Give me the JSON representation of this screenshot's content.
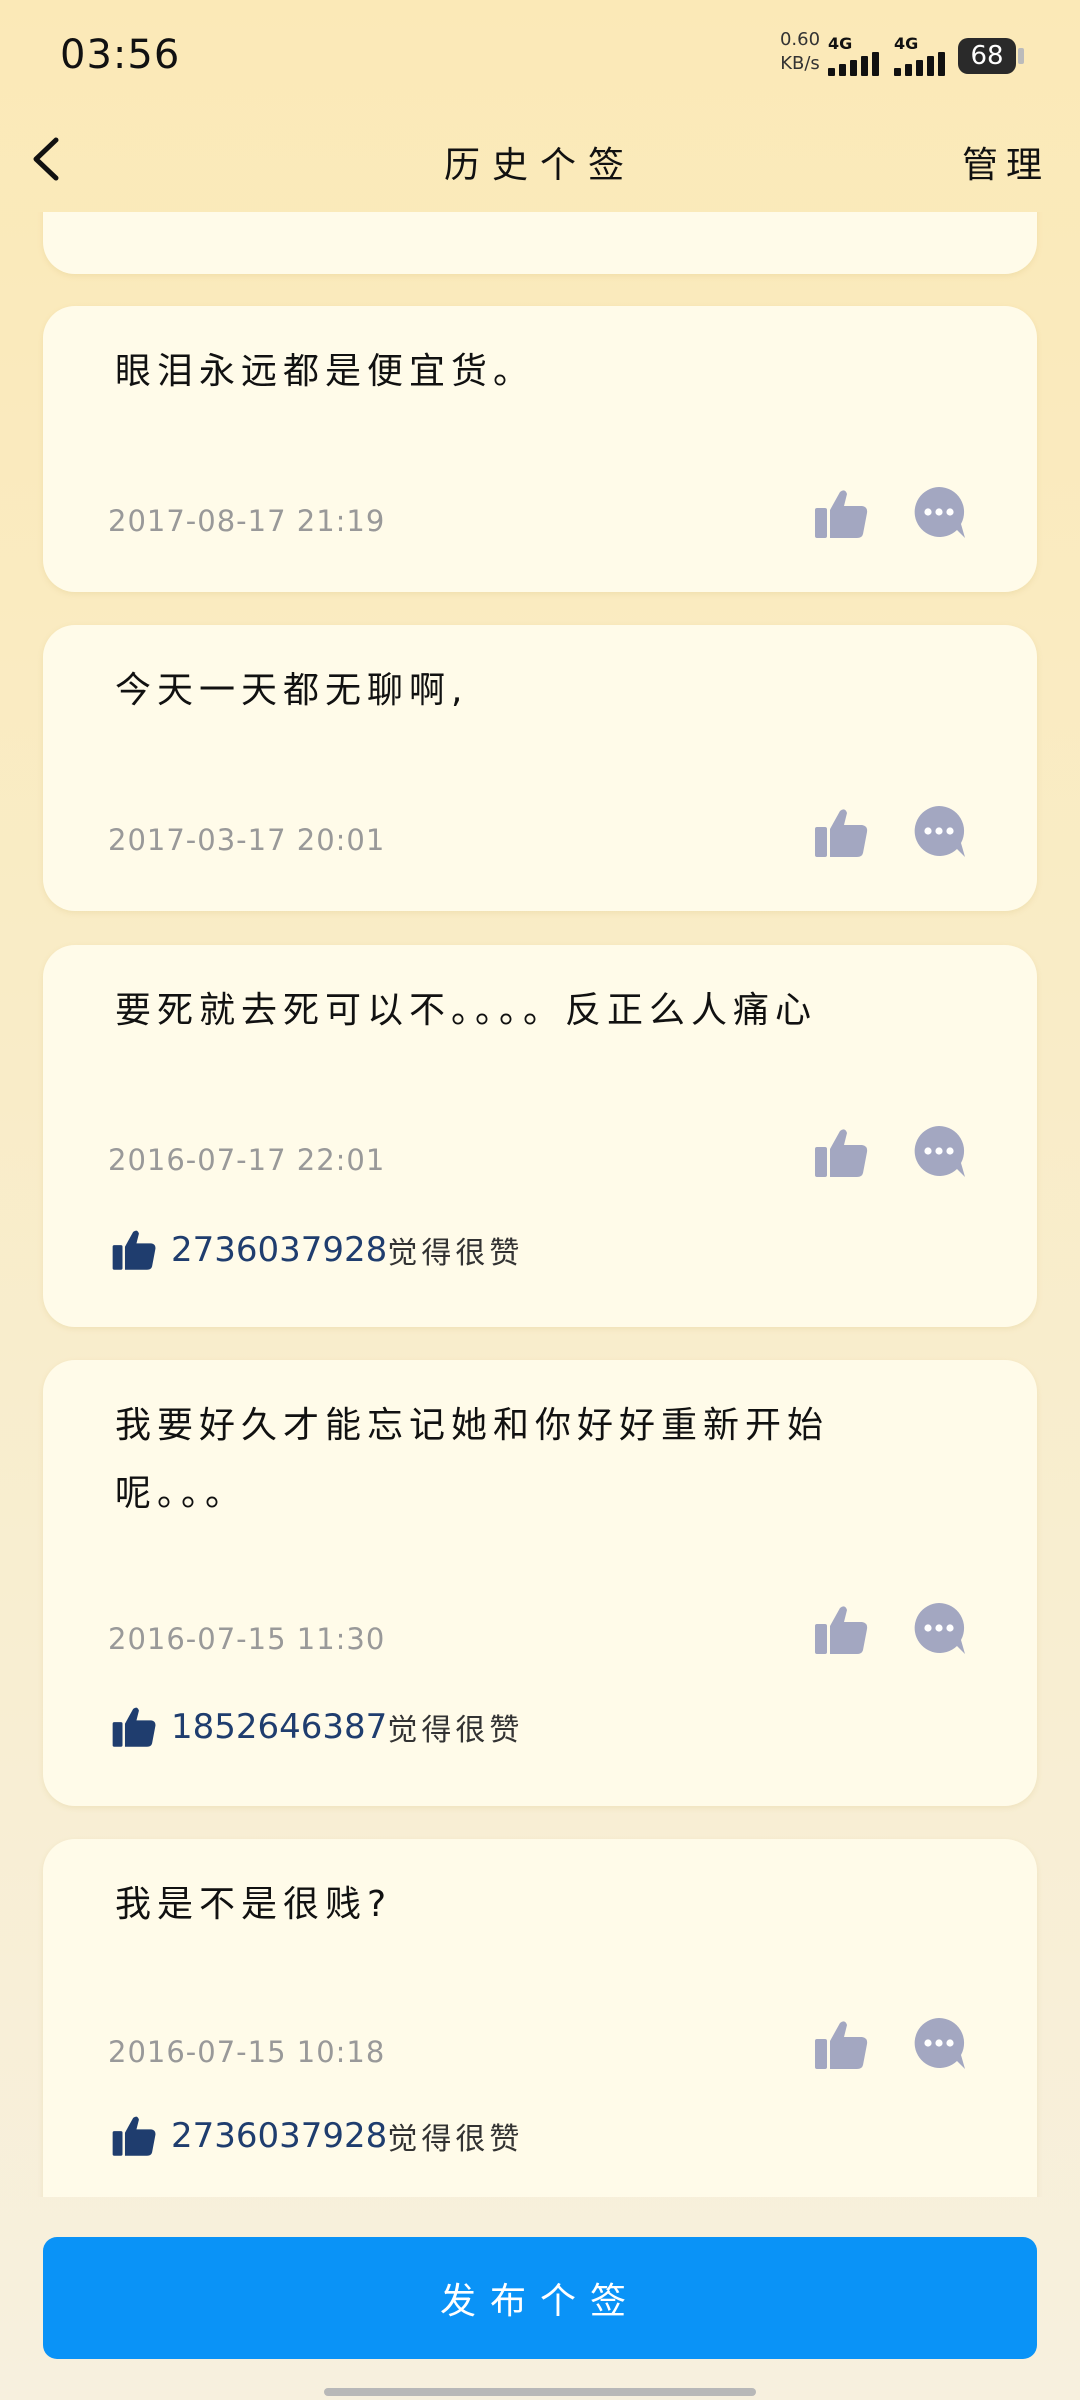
{
  "status_bar": {
    "time": "03:56",
    "net_speed_value": "0.60",
    "net_speed_unit": "KB/s",
    "signal_1": "4G",
    "signal_2": "4G",
    "battery": "68"
  },
  "nav": {
    "title": "历史个签",
    "manage_label": "管理"
  },
  "cards": [
    {
      "text": "眼泪永远都是便宜货。",
      "date": "2017-08-17 21:19"
    },
    {
      "text": "今天一天都无聊啊,",
      "date": "2017-03-17 20:01"
    },
    {
      "text": "要死就去死可以不。。。。反正么人痛心",
      "date": "2016-07-17 22:01",
      "liker_id": "2736037928",
      "liker_suffix": "觉得很赞"
    },
    {
      "text": "我要好久才能忘记她和你好好重新开始呢。。。",
      "date": "2016-07-15 11:30",
      "liker_id": "1852646387",
      "liker_suffix": "觉得很赞"
    },
    {
      "text": "我是不是很贱?",
      "date": "2016-07-15 10:18",
      "liker_id": "2736037928",
      "liker_suffix": "觉得很赞"
    }
  ],
  "publish_label": "发布个签",
  "colors": {
    "accent": "#0a93f7",
    "card_bg": "#fffbe9",
    "icon_gray": "#a3a7c1",
    "thumb_dark": "#1f3d6e"
  }
}
